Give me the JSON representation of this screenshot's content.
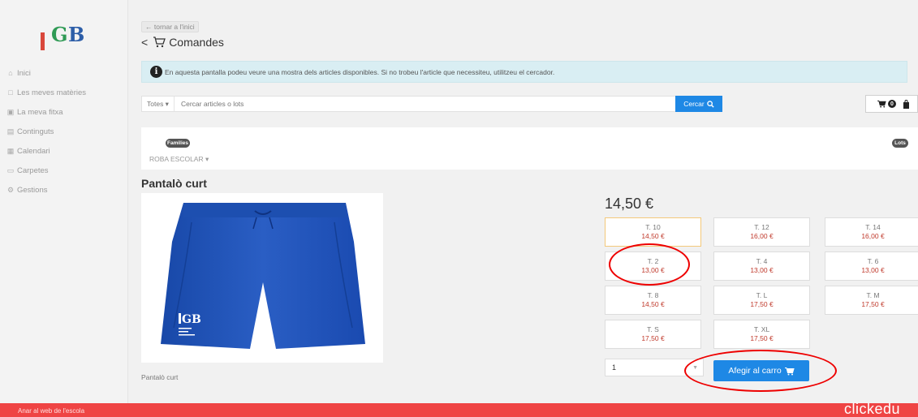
{
  "logo_text": "EGB",
  "sidebar": {
    "items": [
      {
        "label": "Inici",
        "icon": "home-icon"
      },
      {
        "label": "Les meves matèries",
        "icon": "book-icon"
      },
      {
        "label": "La meva fitxa",
        "icon": "id-card-icon"
      },
      {
        "label": "Continguts",
        "icon": "content-icon"
      },
      {
        "label": "Calendari",
        "icon": "calendar-icon"
      },
      {
        "label": "Carpetes",
        "icon": "folder-icon"
      },
      {
        "label": "Gestions",
        "icon": "gears-icon"
      }
    ]
  },
  "header": {
    "back_label": "← tornar a l'inici",
    "title": "Comandes"
  },
  "info": {
    "text": "En aquesta pantalla podeu veure una mostra dels articles disponibles. Si no trobeu l'article que necessiteu, utilitzeu el cercador."
  },
  "search": {
    "filter": "Totes ▾",
    "placeholder": "Cercar articles o lots",
    "button": "Cercar"
  },
  "cart": {
    "count": "0"
  },
  "families": {
    "families_label": "Families",
    "lots_label": "Lots",
    "dropdown": "ROBA ESCOLAR ▾"
  },
  "product": {
    "title": "Pantalò curt",
    "caption": "Pantalò curt",
    "price": "14,50 €",
    "image_logo": "EGB",
    "sizes": [
      {
        "size": "T. 10",
        "price": "14,50 €"
      },
      {
        "size": "T. 12",
        "price": "16,00 €"
      },
      {
        "size": "T. 14",
        "price": "16,00 €"
      },
      {
        "size": "T. 2",
        "price": "13,00 €"
      },
      {
        "size": "T. 4",
        "price": "13,00 €"
      },
      {
        "size": "T. 6",
        "price": "13,00 €"
      },
      {
        "size": "T. 8",
        "price": "14,50 €"
      },
      {
        "size": "T. L",
        "price": "17,50 €"
      },
      {
        "size": "T. M",
        "price": "17,50 €"
      },
      {
        "size": "T. S",
        "price": "17,50 €"
      },
      {
        "size": "T. XL",
        "price": "17,50 €"
      }
    ],
    "selected_size": "T. 10",
    "quantity": "1",
    "add_button": "Afegir al carro"
  },
  "footer": {
    "link": "Anar al web de l'escola",
    "brand": "clickedu"
  },
  "colors": {
    "accent": "#1e88e5",
    "footer": "#ef4444",
    "price": "#c0392b",
    "info_bg": "#d9eef3",
    "annotation": "#e00000"
  }
}
